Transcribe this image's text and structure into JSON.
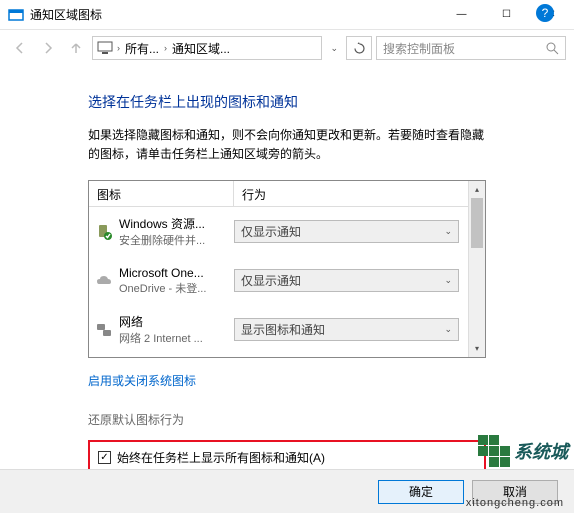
{
  "window": {
    "title": "通知区域图标",
    "minimize": "—",
    "maximize": "☐",
    "close": "✕"
  },
  "nav": {
    "breadcrumb": {
      "item1": "所有...",
      "item2": "通知区域..."
    },
    "search_placeholder": "搜索控制面板"
  },
  "content": {
    "heading": "选择在任务栏上出现的图标和通知",
    "description": "如果选择隐藏图标和通知，则不会向你通知更改和更新。若要随时查看隐藏的图标，请单击任务栏上通知区域旁的箭头。",
    "columns": {
      "icon": "图标",
      "action": "行为"
    },
    "items": [
      {
        "name": "Windows 资源...",
        "sub": "安全删除硬件并...",
        "action": "仅显示通知"
      },
      {
        "name": "Microsoft One...",
        "sub": "OneDrive - 未登...",
        "action": "仅显示通知"
      },
      {
        "name": "网络",
        "sub": "网络 2 Internet ...",
        "action": "显示图标和通知"
      }
    ],
    "link": "启用或关闭系统图标",
    "sublabel": "还原默认图标行为",
    "checkbox_label": "始终在任务栏上显示所有图标和通知(A)"
  },
  "footer": {
    "ok": "确定",
    "cancel": "取消"
  },
  "watermark": {
    "text": "系统城",
    "url": "xitongcheng.com"
  }
}
